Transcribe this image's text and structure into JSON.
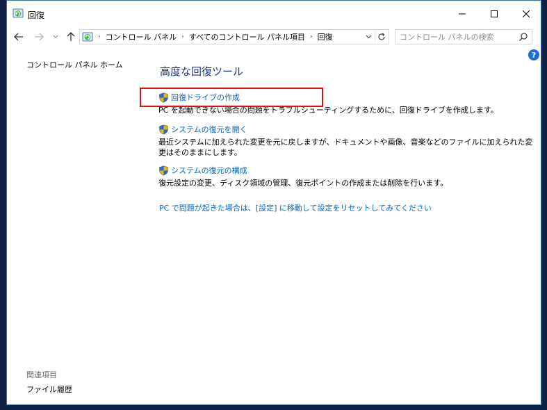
{
  "window": {
    "title": "回復"
  },
  "address_bar": {
    "breadcrumbs": [
      "コントロール パネル",
      "すべてのコントロール パネル項目",
      "回復"
    ],
    "separator": "›"
  },
  "search": {
    "placeholder": "コントロール パネルの検索"
  },
  "left_pane": {
    "home_link": "コントロール パネル ホーム",
    "related_title": "関連項目",
    "related_items": [
      "ファイル履歴"
    ]
  },
  "main": {
    "title": "高度な回復ツール",
    "tasks": [
      {
        "label": "回復ドライブの作成",
        "description": "PC を起動できない場合の問題をトラブルシューティングするために、回復ドライブを作成します。"
      },
      {
        "label": "システムの復元を開く",
        "description": "最近システムに加えられた変更を元に戻しますが、ドキュメントや画像、音楽などのファイルに加えられた変更はそのままにします。"
      },
      {
        "label": "システムの復元の構成",
        "description": "復元設定の変更、ディスク領域の管理、復元ポイントの作成または削除を行います。"
      }
    ],
    "reset_link": "PC で問題が起きた場合は、[設定] に移動して設定をリセットしてみてください"
  },
  "help": {
    "glyph": "?"
  },
  "icons": {
    "app": "recovery-icon",
    "task": "uac-shield-icon",
    "search": "search-icon"
  },
  "colors": {
    "link": "#0066cc",
    "title": "#1e3287",
    "highlight": "#e31010",
    "desktop": "#0f1f46"
  }
}
